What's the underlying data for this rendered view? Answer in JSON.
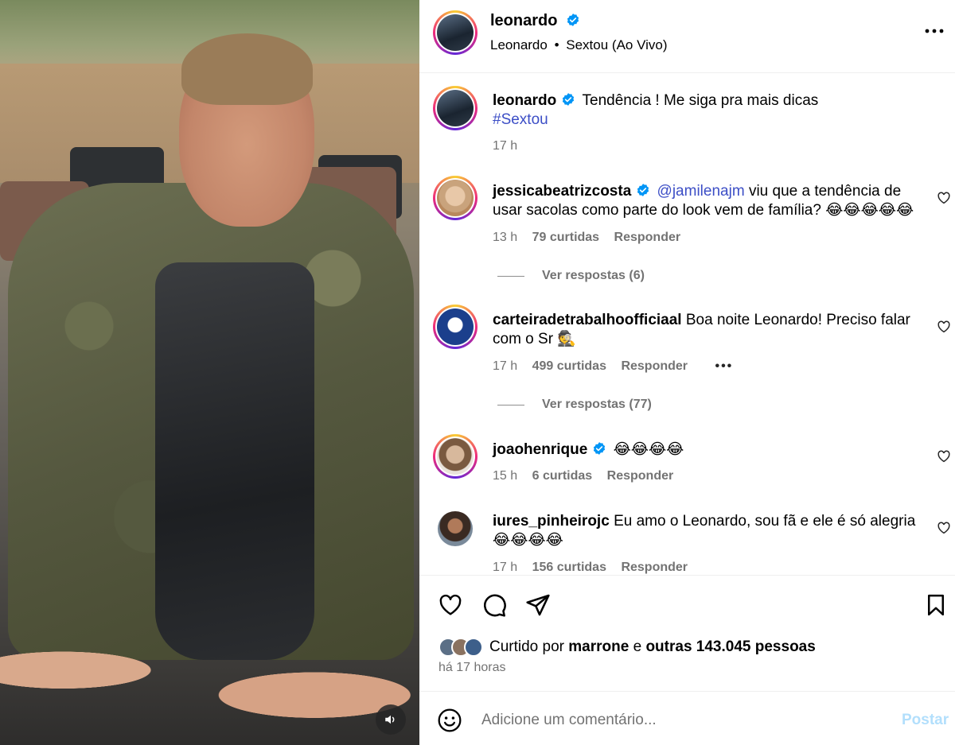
{
  "post": {
    "author": "leonardo",
    "audio_artist": "Leonardo",
    "audio_separator": "•",
    "audio_title": "Sextou (Ao Vivo)"
  },
  "caption": {
    "username": "leonardo",
    "text": "Tendência ! Me siga pra mais dicas",
    "hashtag": "#Sextou",
    "time": "17 h"
  },
  "comments": [
    {
      "username": "jessicabeatrizcosta",
      "verified": true,
      "mention": "@jamilenajm",
      "text": "viu que a tendência de usar sacolas como parte do look vem de família? 😂😂😂😂😂",
      "time": "13 h",
      "likes": "79 curtidas",
      "reply_label": "Responder",
      "view_replies": "Ver respostas (6)"
    },
    {
      "username": "carteiradetrabalhoofficiaal",
      "verified": false,
      "text": "Boa noite Leonardo! Preciso falar com o Sr 🕵️",
      "time": "17 h",
      "likes": "499 curtidas",
      "reply_label": "Responder",
      "more": "•••",
      "view_replies": "Ver respostas (77)"
    },
    {
      "username": "joaohenrique",
      "verified": true,
      "text": "😂😂😂😂",
      "time": "15 h",
      "likes": "6 curtidas",
      "reply_label": "Responder"
    },
    {
      "username": "iures_pinheirojc",
      "verified": false,
      "text": "Eu amo o Leonardo, sou fã e ele é só alegria 😂😂😂😂",
      "time": "17 h",
      "likes": "156 curtidas",
      "reply_label": "Responder"
    }
  ],
  "likes_summary": {
    "prefix": "Curtido por",
    "first_user": "marrone",
    "connector": "e",
    "others": "outras 143.045 pessoas",
    "posted_ago": "há 17 horas"
  },
  "composer": {
    "placeholder": "Adicione um comentário...",
    "post_label": "Postar"
  },
  "colors": {
    "verified": "#0095f6",
    "link": "#3c4ec6",
    "muted_text": "#737373",
    "post_button_disabled": "#b2dffc"
  },
  "icons": [
    "verified-badge-icon",
    "more-options-icon",
    "heart-icon",
    "comment-icon",
    "share-icon",
    "bookmark-icon",
    "emoji-icon",
    "volume-icon"
  ]
}
